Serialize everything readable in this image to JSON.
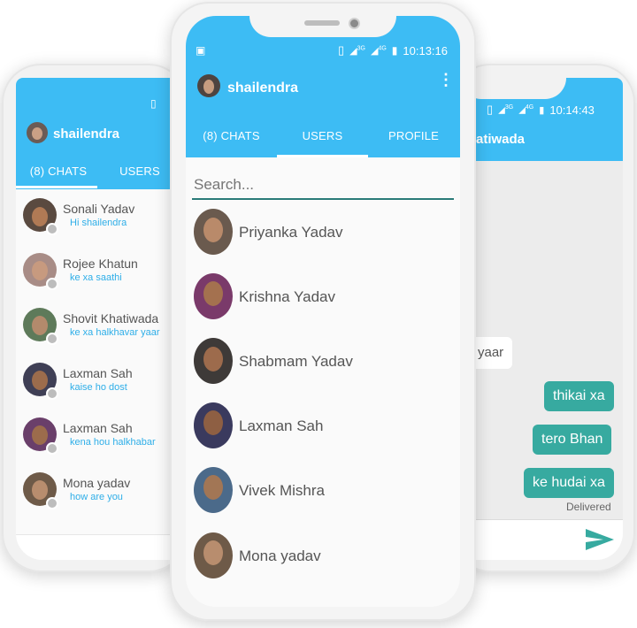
{
  "left_phone": {
    "username": "shailendra",
    "tabs": [
      {
        "label": "(8) CHATS"
      },
      {
        "label": "USERS"
      }
    ],
    "chats": [
      {
        "name": "Sonali Yadav",
        "message": "Hi shailendra"
      },
      {
        "name": "Rojee Khatun",
        "message": "ke xa saathi"
      },
      {
        "name": "Shovit Khatiwada",
        "message": "ke xa halkhavar yaar"
      },
      {
        "name": "Laxman Sah",
        "message": "kaise ho dost"
      },
      {
        "name": "Laxman Sah",
        "message": "kena hou halkhabar"
      },
      {
        "name": "Mona yadav",
        "message": "how are you"
      }
    ]
  },
  "center_phone": {
    "time": "10:13:16",
    "net1": "3G",
    "net2": "4G",
    "username": "shailendra",
    "tabs": [
      {
        "label": "(8) CHATS"
      },
      {
        "label": "USERS"
      },
      {
        "label": "PROFILE"
      }
    ],
    "search": {
      "placeholder": "Search..."
    },
    "users": [
      {
        "name": "Priyanka Yadav"
      },
      {
        "name": "Krishna Yadav"
      },
      {
        "name": "Shabmam Yadav"
      },
      {
        "name": "Laxman Sah"
      },
      {
        "name": "Vivek Mishra"
      },
      {
        "name": "Mona yadav"
      }
    ]
  },
  "right_phone": {
    "time": "10:14:43",
    "net1": "3G",
    "net2": "4G",
    "title_partial": "atiwada",
    "received_partial": "yaar",
    "sent": [
      "thikai xa",
      "tero Bhan",
      "ke hudai xa"
    ],
    "delivered": "Delivered"
  },
  "colors": {
    "appbar": "#3dbcf4",
    "bubble": "#37aaa0",
    "link_text": "#2eaee8"
  }
}
